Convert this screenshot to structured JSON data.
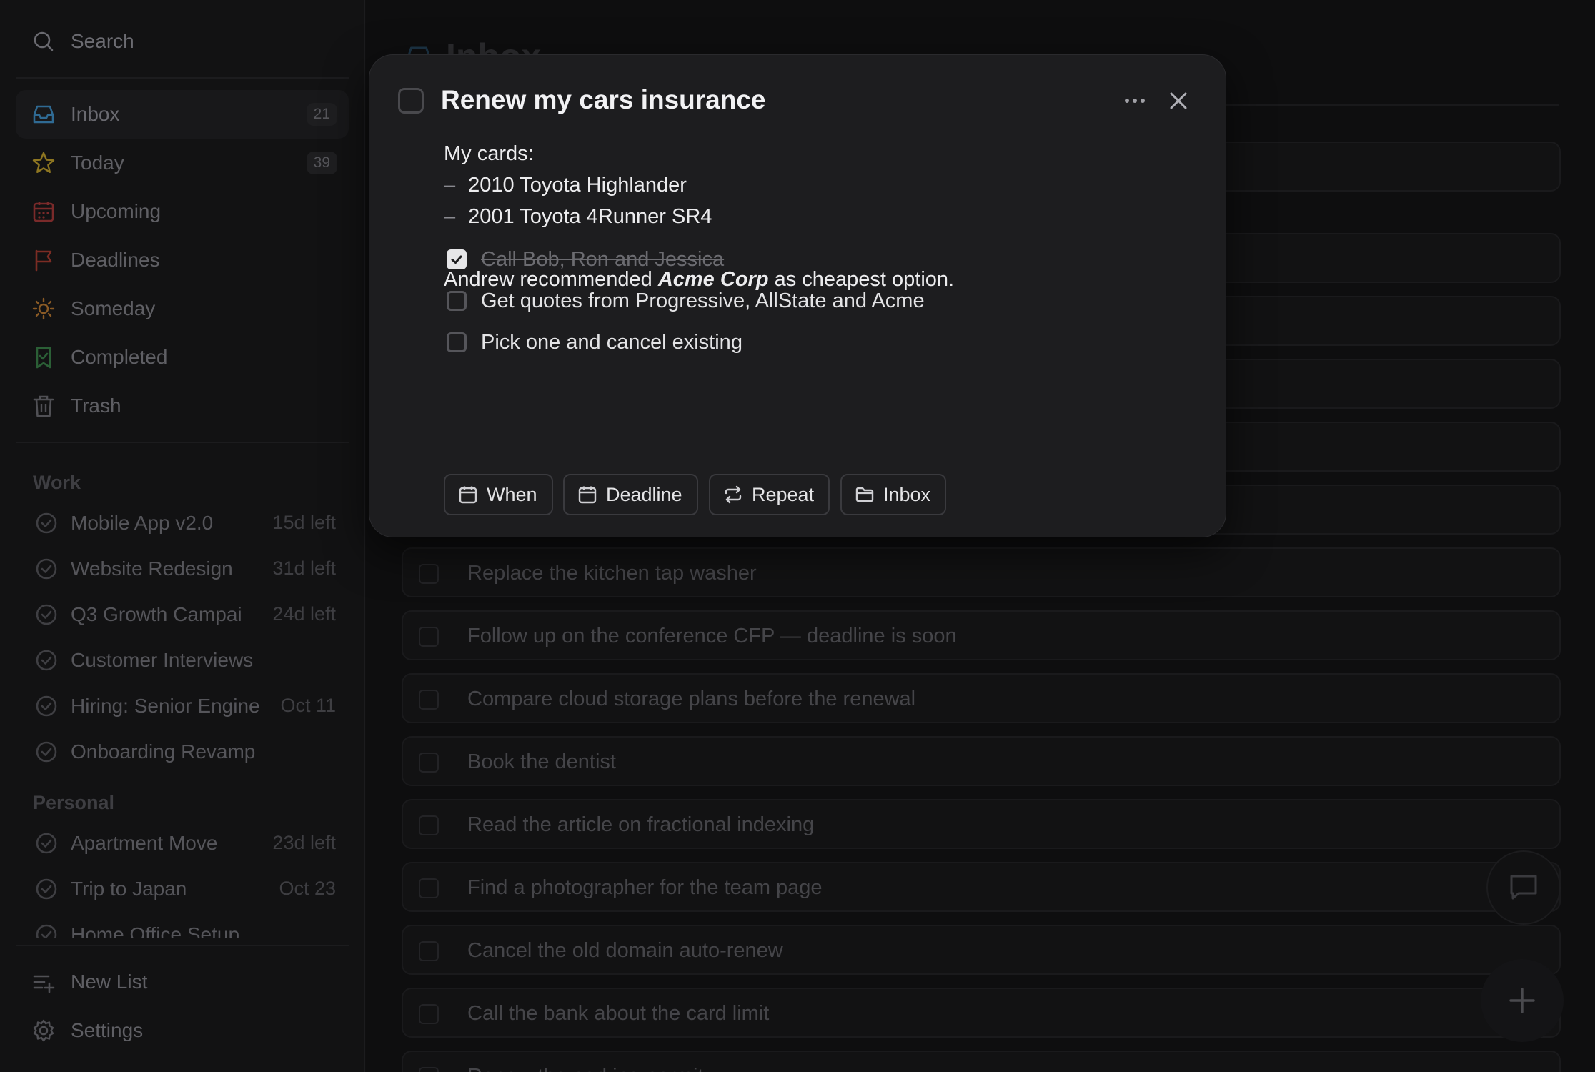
{
  "sidebar": {
    "search_label": "Search",
    "nav": [
      {
        "label": "Inbox",
        "count": "21"
      },
      {
        "label": "Today",
        "count": "39"
      },
      {
        "label": "Upcoming"
      },
      {
        "label": "Deadlines"
      },
      {
        "label": "Someday"
      },
      {
        "label": "Completed"
      },
      {
        "label": "Trash"
      }
    ],
    "sections": [
      {
        "title": "Work",
        "projects": [
          {
            "name": "Mobile App v2.0",
            "due": "15d left"
          },
          {
            "name": "Website Redesign",
            "due": "31d left"
          },
          {
            "name": "Q3 Growth Campai",
            "due": "24d left"
          },
          {
            "name": "Customer Interviews",
            "due": ""
          },
          {
            "name": "Hiring: Senior Engine",
            "due": "Oct 11"
          },
          {
            "name": "Onboarding Revamp",
            "due": ""
          }
        ]
      },
      {
        "title": "Personal",
        "projects": [
          {
            "name": "Apartment Move",
            "due": "23d left"
          },
          {
            "name": "Trip to Japan",
            "due": "Oct 23"
          },
          {
            "name": "Home Office Setup",
            "due": ""
          }
        ]
      }
    ],
    "footer": {
      "new_list": "New List",
      "settings": "Settings"
    }
  },
  "main": {
    "title": "Inbox",
    "tasks": [
      "Replace the kitchen tap washer",
      "Follow up on the conference CFP — deadline is soon",
      "Compare cloud storage plans before the renewal",
      "Book the dentist",
      "Read the article on fractional indexing",
      "Find a photographer for the team page",
      "Cancel the old domain auto-renew",
      "Call the bank about the card limit",
      "Renew the parking permit"
    ]
  },
  "modal": {
    "title": "Renew my cars insurance",
    "notes": {
      "heading": "My cards:",
      "items": [
        "2010 Toyota Highlander",
        "2001 Toyota 4Runner SR4"
      ],
      "rec_prefix": "Andrew recommended ",
      "rec_em": "Acme Corp",
      "rec_suffix": " as cheapest option."
    },
    "checklist": [
      {
        "text": "Call Bob, Ron and Jessica",
        "done": true
      },
      {
        "text": "Get quotes from Progressive, AllState and Acme",
        "done": false
      },
      {
        "text": "Pick one and cancel existing",
        "done": false
      }
    ],
    "buttons": {
      "when": "When",
      "deadline": "Deadline",
      "repeat": "Repeat",
      "list": "Inbox"
    }
  },
  "colors": {
    "today": "#b89a2b",
    "upcoming": "#8a2c2c",
    "deadlines": "#8a3128",
    "someday": "#a0682a",
    "completed": "#2d6a3a",
    "inbox": "#3a7fb0"
  }
}
